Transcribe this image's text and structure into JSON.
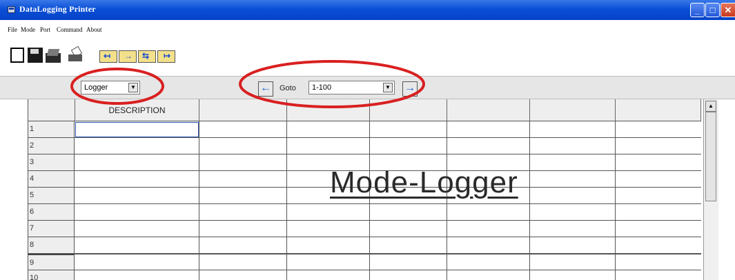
{
  "window": {
    "title": "DataLogging Printer",
    "icon": "app-icon",
    "controls": [
      "minimize-icon",
      "maximize-icon",
      "close-icon"
    ]
  },
  "menu": {
    "file": "File",
    "mode": "Mode",
    "port": "Port",
    "command": "Command",
    "about": "About"
  },
  "toolbar": {
    "icons": [
      "new-icon",
      "save-icon",
      "open-icon",
      "print-icon",
      "folder-up-icon",
      "folder-export-icon",
      "folder-import-icon",
      "folder-forward-icon"
    ]
  },
  "controls": {
    "mode_select_value": "Logger",
    "goto_label": "Goto",
    "goto_range_value": "1-100",
    "prev_icon": "arrow-left-icon",
    "next_icon": "arrow-right-icon"
  },
  "grid": {
    "columns": [
      "DESCRIPTION",
      "",
      "",
      "",
      "",
      "",
      ""
    ],
    "rows": [
      "1",
      "2",
      "3",
      "4",
      "5",
      "6",
      "7",
      "8",
      "9",
      "10"
    ]
  },
  "annotation": {
    "label": "Mode-Logger",
    "highlight_color": "#d92020"
  },
  "colors": {
    "titlebar": "#0a4fd6",
    "nav_arrow": "#1560d8"
  }
}
